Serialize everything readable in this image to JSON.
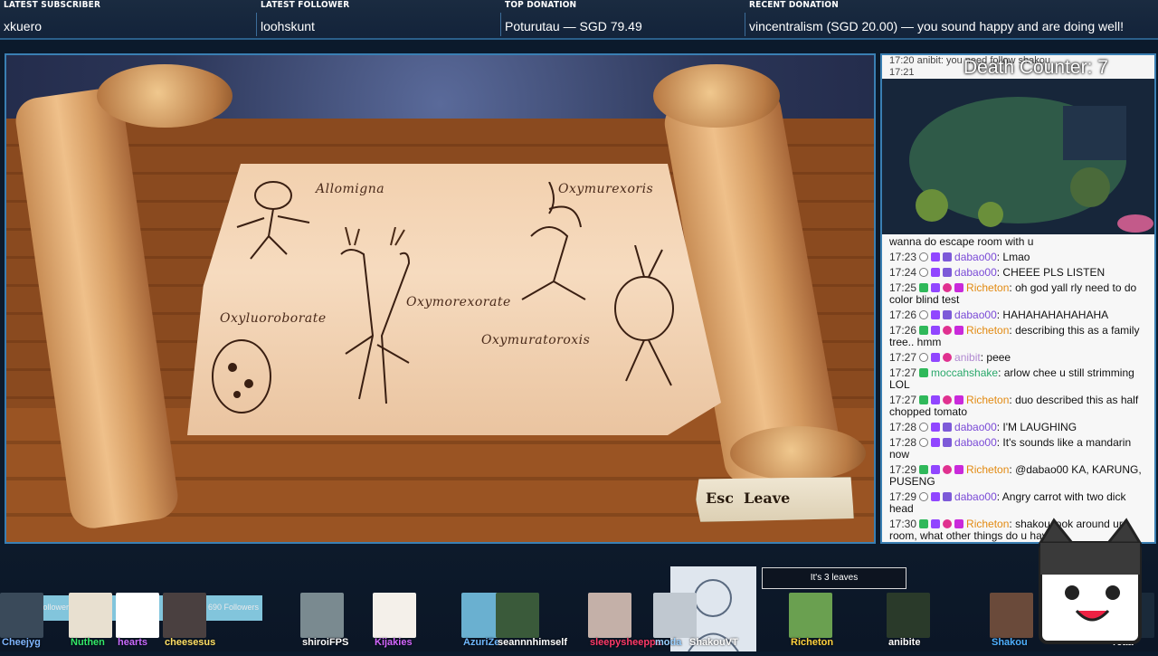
{
  "ticker": [
    {
      "heading": "LATEST SUBSCRIBER",
      "value": "xkuero"
    },
    {
      "heading": "LATEST FOLLOWER",
      "value": "loohskunt"
    },
    {
      "heading": "TOP DONATION",
      "value": "Poturutau — SGD 79.49"
    },
    {
      "heading": "RECENT DONATION",
      "value": "vincentralism (SGD 20.00) — you sound happy and are doing well!"
    }
  ],
  "game": {
    "labels": [
      "Allomigna",
      "Oxymurexoris",
      "Oxymorexorate",
      "Oxyluoroborate",
      "Oxymuratoroxis"
    ],
    "leave_key": "Esc",
    "leave_label": "Leave"
  },
  "side": {
    "death_counter": "Death Counter: 7",
    "top_lines": [
      {
        "time": "17:20",
        "text": "anibit: you need follow shakou"
      },
      {
        "time": "17:21",
        "text": ""
      }
    ],
    "chat": [
      {
        "time": "",
        "user": "",
        "text": "wanna do escape room with u",
        "badges": []
      },
      {
        "time": "17:23",
        "user": "dabao00",
        "cls": "",
        "text": "Lmao",
        "badges": [
          "user",
          "sub",
          "art"
        ]
      },
      {
        "time": "17:24",
        "user": "dabao00",
        "cls": "",
        "text": "CHEEE PLS LISTEN",
        "badges": [
          "user",
          "sub",
          "art"
        ]
      },
      {
        "time": "17:25",
        "user": "Richeton",
        "cls": "rich",
        "text": "oh god yall rly need to do color blind test",
        "badges": [
          "mod",
          "sub",
          "gift",
          "vip"
        ]
      },
      {
        "time": "17:26",
        "user": "dabao00",
        "cls": "",
        "text": "HAHAHAHAHAHAHA",
        "badges": [
          "user",
          "sub",
          "art"
        ]
      },
      {
        "time": "17:26",
        "user": "Richeton",
        "cls": "rich",
        "text": "describing this as a family tree.. hmm",
        "badges": [
          "mod",
          "sub",
          "gift",
          "vip"
        ]
      },
      {
        "time": "17:27",
        "user": "anibit",
        "cls": "anib",
        "text": "peee",
        "badges": [
          "user",
          "sub",
          "gift"
        ]
      },
      {
        "time": "17:27",
        "user": "moccahshake",
        "cls": "mocc",
        "text": "arlow chee u still strimming LOL",
        "badges": [
          "mod"
        ]
      },
      {
        "time": "17:27",
        "user": "Richeton",
        "cls": "rich",
        "text": "duo described this as half chopped tomato",
        "badges": [
          "mod",
          "sub",
          "gift",
          "vip"
        ]
      },
      {
        "time": "17:28",
        "user": "dabao00",
        "cls": "",
        "text": "I'M LAUGHING",
        "badges": [
          "user",
          "sub",
          "art"
        ]
      },
      {
        "time": "17:28",
        "user": "dabao00",
        "cls": "",
        "text": "It's sounds like a mandarin now",
        "badges": [
          "user",
          "sub",
          "art"
        ]
      },
      {
        "time": "17:29",
        "user": "Richeton",
        "cls": "rich",
        "text": "@dabao00 KA, KARUNG, PUSENG",
        "badges": [
          "mod",
          "sub",
          "gift",
          "vip"
        ]
      },
      {
        "time": "17:29",
        "user": "dabao00",
        "cls": "",
        "text": "Angry carrot with two dick head",
        "badges": [
          "user",
          "sub",
          "art"
        ]
      },
      {
        "time": "17:30",
        "user": "Richeton",
        "cls": "rich",
        "text": "shakou look around ur room, what other things do u have",
        "badges": [
          "mod",
          "sub",
          "gift",
          "vip"
        ]
      }
    ]
  },
  "bottom": {
    "goal_label": "Follower Goal",
    "goal_value": "685 / 690 Followers",
    "goal_fraction": 0.993,
    "tooltip": "It's 3 leaves",
    "names": [
      {
        "text": "Cheejyg",
        "color": "#7fb6ff"
      },
      {
        "text": "Nuthen",
        "color": "#33e86a"
      },
      {
        "text": "hearts",
        "color": "#c86bff"
      },
      {
        "text": "cheesesus",
        "color": "#ffe066"
      },
      {
        "text": "shiroiFPS",
        "color": "#ffffff"
      },
      {
        "text": "Kijakies",
        "color": "#d266ff"
      },
      {
        "text": "AzuriZe",
        "color": "#6fb8ff"
      },
      {
        "text": "seannnhimself",
        "color": "#ffffff"
      },
      {
        "text": "sleepysheeppa",
        "color": "#ff3a6a"
      },
      {
        "text": "moda",
        "color": "#9ad0ff"
      },
      {
        "text": "ShakouVT",
        "color": "#ffffff"
      },
      {
        "text": "Richeton",
        "color": "#ffd23f"
      },
      {
        "text": "anibite",
        "color": "#ffffff"
      },
      {
        "text": "Shakou",
        "color": "#4fb0ff"
      },
      {
        "text": "reaa",
        "color": "#ffffff"
      }
    ]
  }
}
